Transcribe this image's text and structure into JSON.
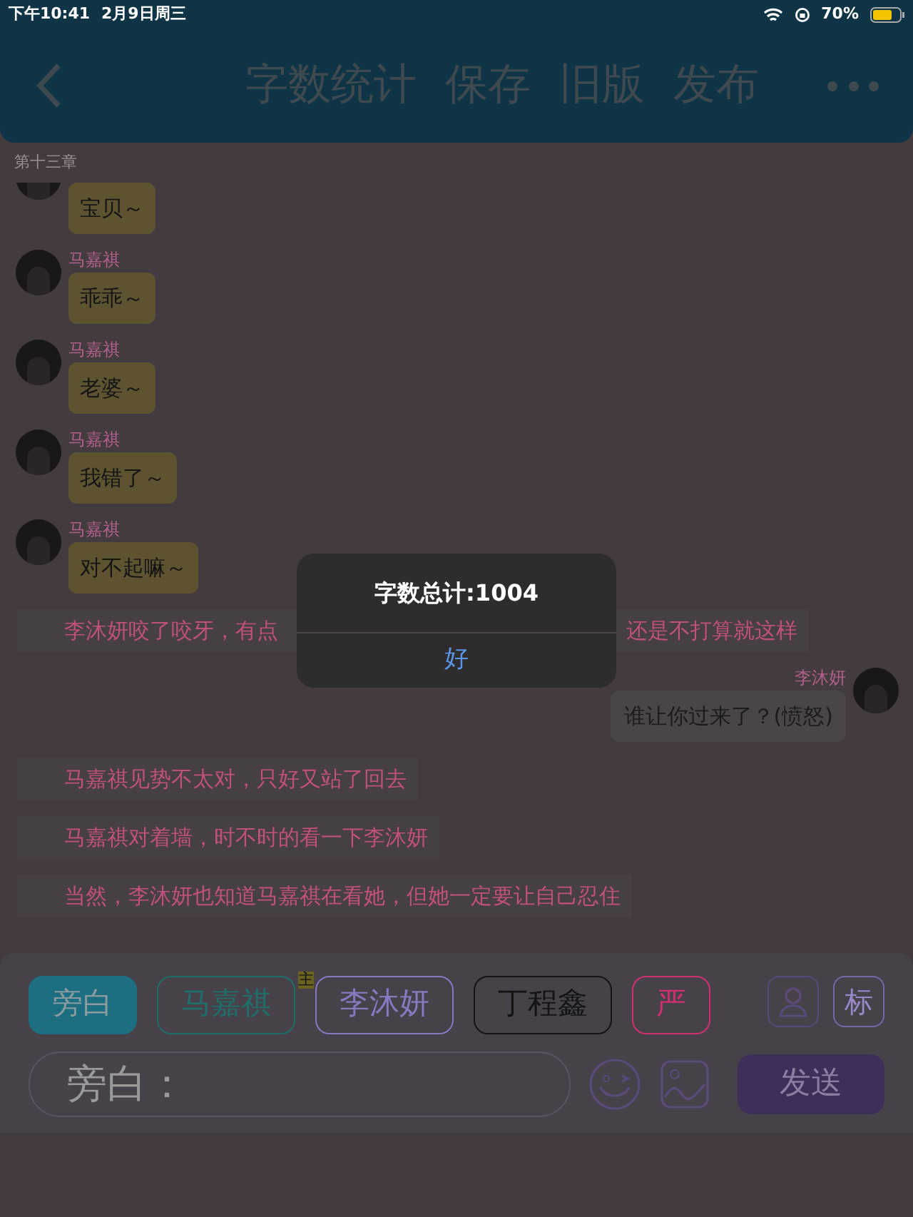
{
  "status_bar": {
    "time": "下午10:41",
    "date": "2月9日周三",
    "battery": "70%"
  },
  "header": {
    "actions": [
      "字数统计",
      "保存",
      "旧版",
      "发布"
    ]
  },
  "chapter": "第十三章",
  "messages": [
    {
      "kind": "left",
      "text": "宝贝～"
    },
    {
      "kind": "left",
      "name": "马嘉祺",
      "text": "乖乖～"
    },
    {
      "kind": "left",
      "name": "马嘉祺",
      "text": "老婆～"
    },
    {
      "kind": "left",
      "name": "马嘉祺",
      "text": "我错了～"
    },
    {
      "kind": "left",
      "name": "马嘉祺",
      "text": "对不起嘛～"
    },
    {
      "kind": "narration_split",
      "text": "李沐妍咬了咬牙，有点",
      "text_end": "还是不打算就这样"
    },
    {
      "kind": "right",
      "name": "李沐妍",
      "text": "谁让你过来了？(愤怒)"
    },
    {
      "kind": "narration",
      "text": "马嘉祺见势不太对，只好又站了回去"
    },
    {
      "kind": "narration",
      "text": "马嘉祺对着墙，时不时的看一下李沐妍"
    },
    {
      "kind": "narration",
      "text": "当然，李沐妍也知道马嘉祺在看她，但她一定要让自己忍住"
    }
  ],
  "characters": [
    {
      "label": "旁白",
      "selected": true,
      "color": "#1d6e80"
    },
    {
      "label": "马嘉祺",
      "selected": false,
      "color": "#1f6e6a"
    },
    {
      "label": "李沐妍",
      "selected": false,
      "color": "#8a78c0",
      "badge": "主"
    },
    {
      "label": "丁程鑫",
      "selected": false,
      "color": "#141414"
    },
    {
      "label": "严",
      "selected": false,
      "color": "#d0306e"
    }
  ],
  "tag_button": "标",
  "input": {
    "placeholder": "旁白："
  },
  "send_button": "发送",
  "dialog": {
    "title": "字数总计:1004",
    "button": "好"
  }
}
